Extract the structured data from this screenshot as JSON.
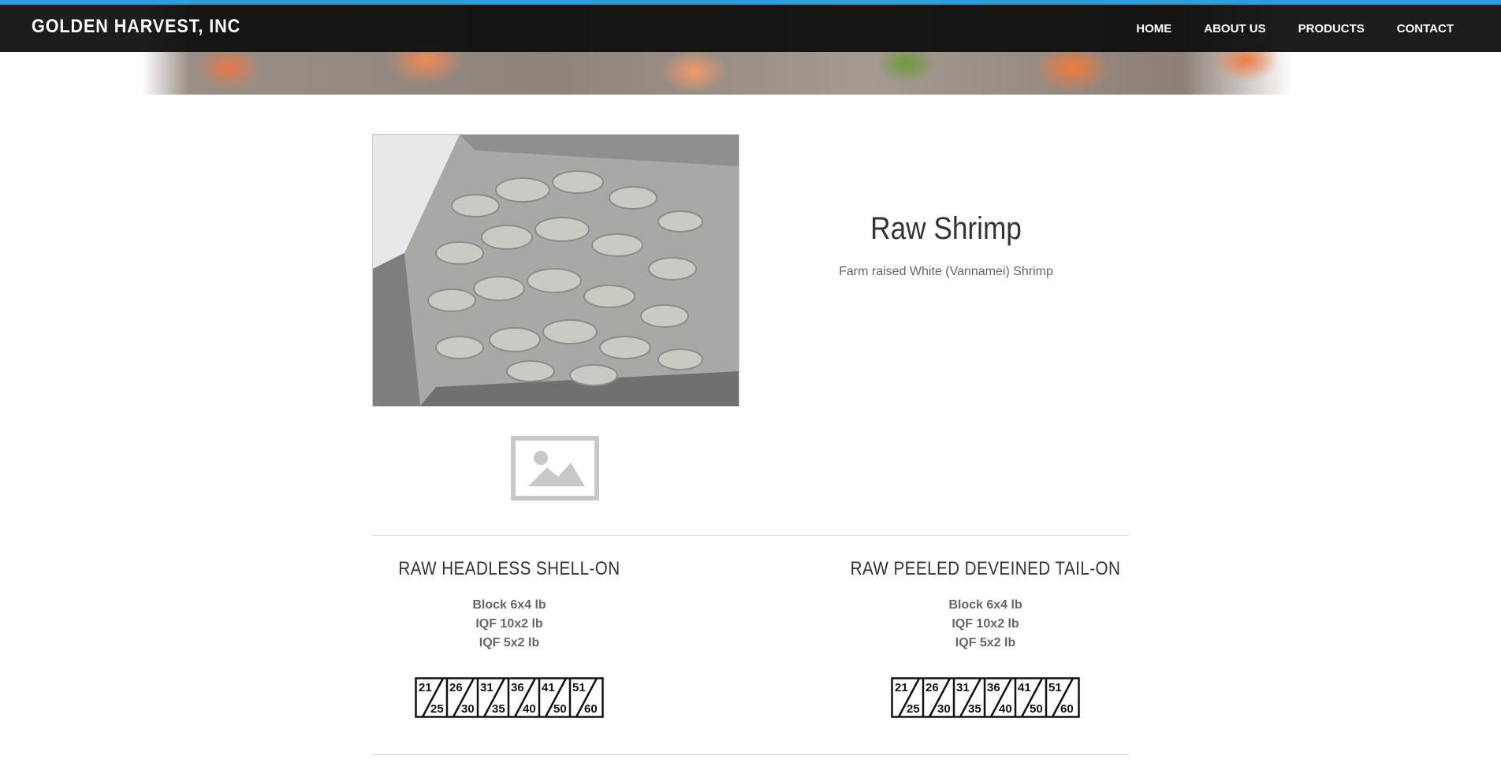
{
  "header": {
    "brand": "GOLDEN HARVEST, INC",
    "nav": [
      "HOME",
      "ABOUT US",
      "PRODUCTS",
      "CONTACT"
    ]
  },
  "product": {
    "title": "Raw Shrimp",
    "subtitle": "Farm raised White (Vannamei) Shrimp",
    "image_icon": "image-placeholder-icon"
  },
  "sections": [
    {
      "title": "RAW HEADLESS SHELL-ON",
      "lines": [
        "Block 6x4 lb",
        "IQF 10x2 lb",
        "IQF 5x2 lb"
      ],
      "sizes": [
        [
          "21",
          "25"
        ],
        [
          "26",
          "30"
        ],
        [
          "31",
          "35"
        ],
        [
          "36",
          "40"
        ],
        [
          "41",
          "50"
        ],
        [
          "51",
          "60"
        ]
      ]
    },
    {
      "title": "RAW PEELED DEVEINED TAIL-ON",
      "lines": [
        "Block 6x4 lb",
        "IQF 10x2 lb",
        "IQF 5x2 lb"
      ],
      "sizes": [
        [
          "21",
          "25"
        ],
        [
          "26",
          "30"
        ],
        [
          "31",
          "35"
        ],
        [
          "36",
          "40"
        ],
        [
          "41",
          "50"
        ],
        [
          "51",
          "60"
        ]
      ]
    }
  ],
  "colors": {
    "accent": "#2a9fd8",
    "navbar": "#0c0c0c",
    "heading": "#333333",
    "text": "#666666"
  }
}
